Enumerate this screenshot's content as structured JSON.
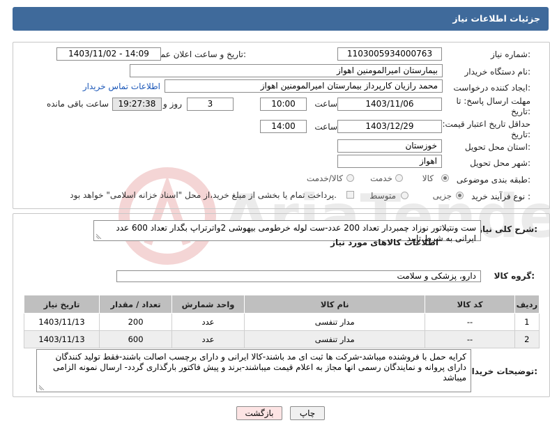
{
  "header": {
    "title": "جزئیات اطلاعات نیاز"
  },
  "fields": {
    "need_number_label": "شماره نیاز:",
    "need_number": "1103005934000763",
    "announce_label": "تاریخ و ساعت اعلان عمومی:",
    "announce_value": "1403/11/02 - 14:09",
    "buyer_org_label": "نام دستگاه خریدار:",
    "buyer_org": "بیمارستان امیرالمومنین اهواز",
    "creator_label": "ایجاد کننده درخواست:",
    "creator": "محمد رازیان کارپرداز بیمارستان امیرالمومنین اهواز",
    "contact_link": "اطلاعات تماس خریدار",
    "deadline_label_1": "مهلت ارسال پاسخ: تا",
    "deadline_label_2": "تاریخ:",
    "deadline_date": "1403/11/06",
    "time_label": "ساعت",
    "deadline_time": "10:00",
    "days_value": "3",
    "days_label": "روز و",
    "remaining_time": "19:27:38",
    "remaining_label": "ساعت باقی مانده",
    "validity_label_1": "حداقل تاریخ اعتبار قیمت: تا",
    "validity_label_2": "تاریخ:",
    "validity_date": "1403/12/29",
    "validity_time_label": "ساعت",
    "validity_time": "14:00",
    "province_label": "استان محل تحویل:",
    "province": "خوزستان",
    "city_label": "شهر محل تحویل:",
    "city": "اهواز",
    "category_label": "طبقه بندی موضوعی:",
    "category_options": [
      "کالا",
      "خدمت",
      "کالا/خدمت"
    ],
    "category_selected": "کالا",
    "purchase_type_label": "نوع فرآیند خرید :",
    "purchase_type_options": [
      "جزیی",
      "متوسط"
    ],
    "purchase_type_selected": "جزیی",
    "payment_note": "پرداخت تمام یا بخشی از مبلغ خرید،از محل \"اسناد خزانه اسلامی\" خواهد بود."
  },
  "section2": {
    "description_label": "شرح کلی نیاز:",
    "description": "ست ونتیلاتور نوزاد چمبردار تعداد 200 عدد-ست لوله خرطومی بیهوشی 2واترتراپ بگدار تعداد 600 عدد ایرانی به شرط تایید",
    "goods_info_title": "اطلاعات کالاهای مورد نیاز",
    "goods_group_label": "گروه کالا:",
    "goods_group": "دارو، پزشکی و سلامت",
    "table": {
      "headers": [
        "ردیف",
        "کد کالا",
        "نام کالا",
        "واحد شمارش",
        "تعداد / مقدار",
        "تاریخ نیاز"
      ],
      "rows": [
        {
          "row": "1",
          "code": "--",
          "name": "مدار تنفسی",
          "unit": "عدد",
          "qty": "200",
          "date": "1403/11/13"
        },
        {
          "row": "2",
          "code": "--",
          "name": "مدار تنفسی",
          "unit": "عدد",
          "qty": "600",
          "date": "1403/11/13"
        }
      ]
    },
    "buyer_notes_label": "توضیحات خریدار:",
    "buyer_notes": "کرایه حمل با فروشنده میباشد-شرکت ها ثبت ای مد باشند-کالا ایرانی و دارای برچسب اصالت باشند-فقط تولید کنندگان دارای پروانه و نمایندگان رسمی انها مجاز به اعلام قیمت میباشند-برند و پیش فاکتور بارگذاری گردد- ارسال نمونه الزامی میباشد"
  },
  "buttons": {
    "print": "چاپ",
    "back": "بازگشت"
  },
  "watermark": {
    "text": "AriaTender.net"
  },
  "colors": {
    "header_bg": "#3f6a9b",
    "link": "#1b57b8",
    "back_btn_bg": "#fde4e4"
  }
}
